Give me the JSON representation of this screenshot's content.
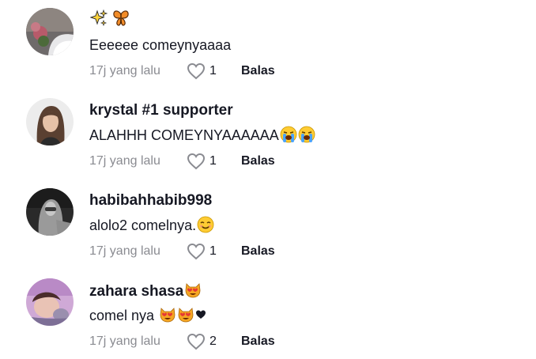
{
  "comments": [
    {
      "username": "",
      "username_emojis": [
        "sparkles-icon",
        "butterfly-icon"
      ],
      "text": "Eeeeee comeynyaaaa",
      "text_emojis": [],
      "time": "17j yang lalu",
      "likes": "1",
      "reply_label": "Balas"
    },
    {
      "username": "krystal #1 supporter",
      "username_emojis": [],
      "text": "ALAHHH COMEYNYAAAAAA",
      "text_emojis": [
        "loudly-crying-face-icon",
        "loudly-crying-face-icon"
      ],
      "time": "17j yang lalu",
      "likes": "1",
      "reply_label": "Balas"
    },
    {
      "username": "habibahhabib998",
      "username_emojis": [],
      "text": "alolo2 comelnya.",
      "text_emojis": [
        "smiling-face-icon"
      ],
      "time": "17j yang lalu",
      "likes": "1",
      "reply_label": "Balas"
    },
    {
      "username": "zahara shasa",
      "username_emojis": [
        "heart-eyes-cat-icon"
      ],
      "text": "comel nya",
      "text_emojis": [
        "heart-eyes-cat-icon",
        "heart-eyes-cat-icon",
        "black-heart-icon"
      ],
      "time": "17j yang lalu",
      "likes": "2",
      "reply_label": "Balas"
    }
  ]
}
